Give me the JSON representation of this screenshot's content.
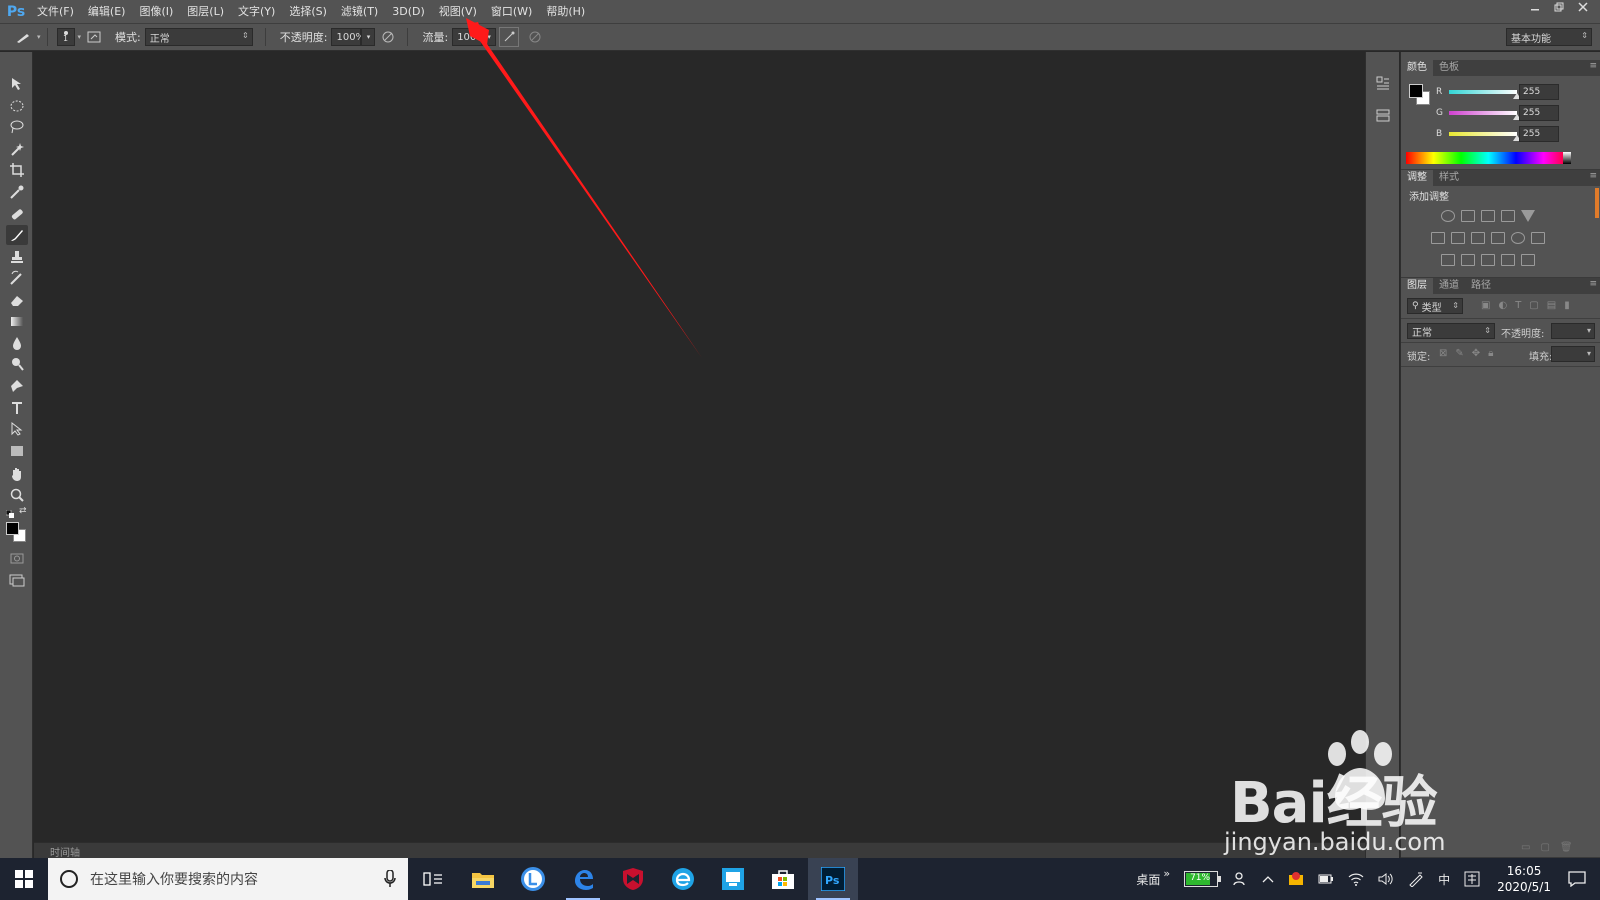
{
  "app": {
    "logo": "Ps"
  },
  "menu": [
    "文件(F)",
    "编辑(E)",
    "图像(I)",
    "图层(L)",
    "文字(Y)",
    "选择(S)",
    "滤镜(T)",
    "3D(D)",
    "视图(V)",
    "窗口(W)",
    "帮助(H)"
  ],
  "options": {
    "brush_size": "1",
    "mode_label": "模式:",
    "mode_value": "正常",
    "opacity_label": "不透明度:",
    "opacity_value": "100%",
    "flow_label": "流量:",
    "flow_value": "100%",
    "workspace": "基本功能"
  },
  "timeline": "时间轴",
  "color_panel": {
    "tabs": [
      "颜色",
      "色板"
    ],
    "channels": [
      {
        "name": "R",
        "value": "255",
        "color": "#33cfd6"
      },
      {
        "name": "G",
        "value": "255",
        "color": "#d040d0"
      },
      {
        "name": "B",
        "value": "255",
        "color": "#e8e830"
      }
    ]
  },
  "adjust_panel": {
    "tabs": [
      "调整",
      "样式"
    ],
    "title": "添加调整"
  },
  "layers_panel": {
    "tabs": [
      "图层",
      "通道",
      "路径"
    ],
    "filter": "类型",
    "blend": "正常",
    "opacity_label": "不透明度:",
    "lock_label": "锁定:",
    "fill_label": "填充:"
  },
  "watermark": {
    "brand": "Bai经验",
    "url": "jingyan.baidu.com"
  },
  "taskbar": {
    "search_placeholder": "在这里输入你要搜索的内容",
    "desktop_label": "桌面",
    "battery": "71%",
    "ime": "中",
    "time": "16:05",
    "date": "2020/5/1"
  },
  "colors": {
    "accent_arrow": "#ff1a1a",
    "ps_blue": "#31a8ff"
  }
}
